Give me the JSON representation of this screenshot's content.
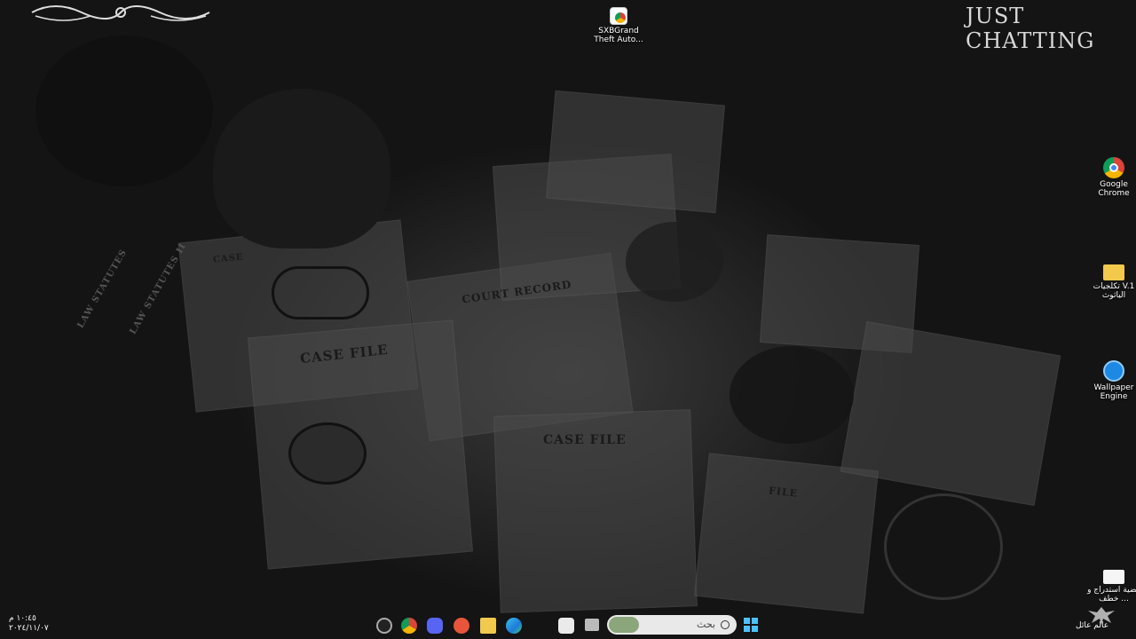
{
  "wallpaper": {
    "overlay_title": "JUST CHATTING",
    "texts": [
      "CASE FILE",
      "COURT RECORD",
      "CASE FILE",
      "CASE",
      "LAW STATUTES",
      "LAW STATUTES II",
      "FILE"
    ]
  },
  "desktop_icons": [
    {
      "label": "SXBGrand Theft Auto...",
      "icon": "chrome-shortcut-icon"
    },
    {
      "label": "Google Chrome",
      "icon": "chrome-icon"
    },
    {
      "label": "تكلجيات V.1 الياثوث",
      "icon": "folder-icon"
    },
    {
      "label": "Wallpaper Engine",
      "icon": "wallpaper-engine-icon"
    },
    {
      "label": "قضية استدراج و خطف ...",
      "icon": "document-icon"
    }
  ],
  "taskbar": {
    "search_placeholder": "بحث",
    "apps": [
      "steam-icon",
      "chrome-icon",
      "discord-icon",
      "cloud-app-icon",
      "file-explorer-icon",
      "edge-icon",
      "store-icon",
      "task-view-icon"
    ],
    "clock_time": "١٠:٤٥ م",
    "clock_date": "٢٠٢٤/١١/٠٧",
    "user_name": "عالم عائل"
  }
}
